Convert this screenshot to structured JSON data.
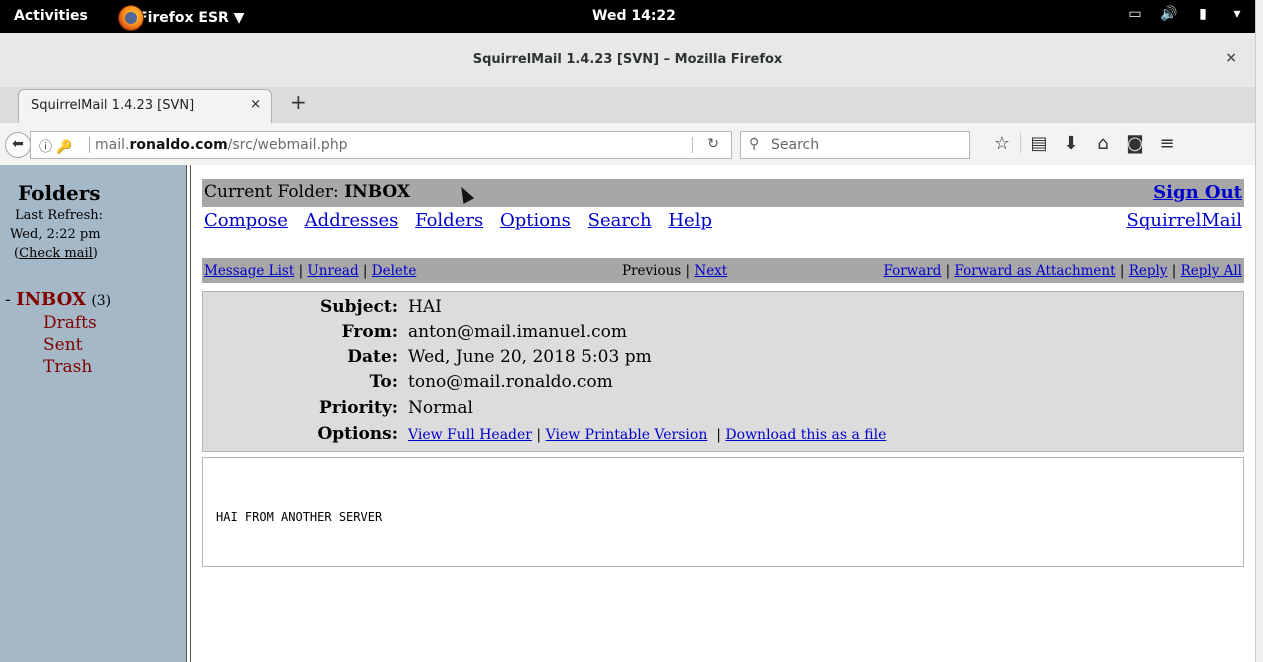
{
  "topbar": {
    "activities": "Activities",
    "app_name": "Firefox ESR ▼",
    "clock": "Wed 14:22",
    "tray_icons": [
      "screen-icon",
      "volume-icon",
      "battery-icon",
      "chevron-down-icon"
    ]
  },
  "window": {
    "title": "SquirrelMail 1.4.23 [SVN] – Mozilla Firefox",
    "close": "×"
  },
  "tabs": [
    {
      "label": "SquirrelMail 1.4.23 [SVN]",
      "close": "×"
    }
  ],
  "newtab": "+",
  "address": {
    "prefix": "mail.",
    "domain": "ronaldo.com",
    "path": "/src/webmail.php"
  },
  "search": {
    "placeholder": "Search"
  },
  "sidebar": {
    "title": "Folders",
    "last_refresh_label": "Last Refresh:",
    "last_refresh_time": "Wed, 2:22 pm",
    "check_mail": "Check mail",
    "inbox": {
      "dash": "-",
      "name": "INBOX",
      "count": "(3)"
    },
    "folders": [
      "Drafts",
      "Sent",
      "Trash"
    ]
  },
  "main": {
    "current_folder_label": "Current Folder:",
    "current_folder": "INBOX",
    "sign_out": "Sign Out",
    "nav": [
      "Compose",
      "Addresses",
      "Folders",
      "Options",
      "Search",
      "Help"
    ],
    "squirrelmail_link": "SquirrelMail"
  },
  "message_bar": {
    "left": [
      "Message List",
      "Unread",
      "Delete"
    ],
    "previous": "Previous",
    "next": "Next",
    "right": [
      "Forward",
      "Forward as Attachment",
      "Reply",
      "Reply All"
    ]
  },
  "headers": {
    "subject_label": "Subject:",
    "subject": "HAI",
    "from_label": "From:",
    "from": "anton@mail.imanuel.com",
    "date_label": "Date:",
    "date": "Wed, June 20, 2018 5:03 pm",
    "to_label": "To:",
    "to": "tono@mail.ronaldo.com",
    "priority_label": "Priority:",
    "priority": "Normal",
    "options_label": "Options:",
    "options": [
      "View Full Header",
      "View Printable Version",
      "Download this as a file"
    ]
  },
  "body": "HAI FROM ANOTHER SERVER",
  "colors": {
    "sidebar_bg": "#a4b8c8",
    "bar_bg": "#a7a7a7",
    "header_bg": "#dcdcdc",
    "link": "#0000cc",
    "folder": "#800000"
  }
}
